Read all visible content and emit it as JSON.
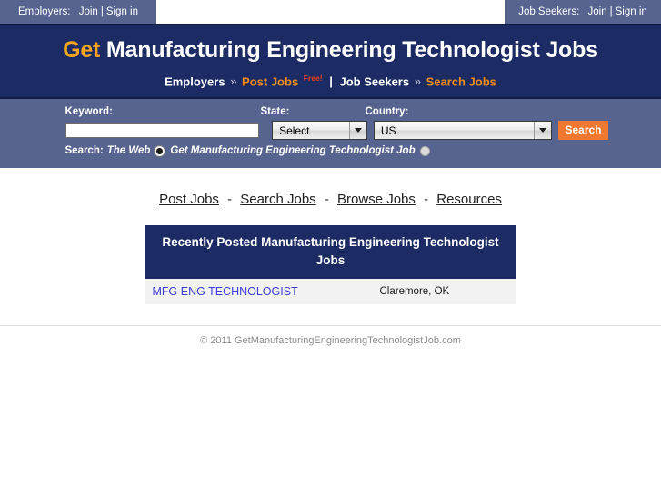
{
  "topbar": {
    "employers_label": "Employers:",
    "employers_join": "Join",
    "employers_signin": "Sign in",
    "jobseekers_label": "Job Seekers:",
    "jobseekers_join": "Join",
    "jobseekers_signin": "Sign in",
    "separator": "|",
    "bg_color": "#56648f"
  },
  "banner": {
    "title_prefix": "Get",
    "title_rest": "Manufacturing Engineering Technologist Jobs",
    "employers_word": "Employers",
    "chevron": "»",
    "post_jobs": "Post Jobs",
    "free_badge": "Free!",
    "pipe": "|",
    "jobseekers_word": "Job Seekers",
    "search_jobs": "Search Jobs",
    "bg_color": "#1c2b63",
    "accent_color": "#f5a51c",
    "link_color": "#f08c1c",
    "free_color": "#e8401f"
  },
  "search": {
    "keyword_label": "Keyword:",
    "state_label": "State:",
    "country_label": "Country:",
    "keyword_value": "",
    "keyword_placeholder": "",
    "state_value": "Select",
    "country_value": "US",
    "search_button": "Search",
    "scope_label": "Search:",
    "scope_web": "The Web",
    "scope_site": "Get Manufacturing Engineering Technologist Job",
    "scope_selected": "The Web",
    "panel_color": "#56648f",
    "button_color": "#f07830"
  },
  "nav": {
    "separator": "-",
    "items": [
      {
        "label": "Post Jobs"
      },
      {
        "label": "Search Jobs"
      },
      {
        "label": "Browse Jobs"
      },
      {
        "label": "Resources"
      }
    ]
  },
  "results": {
    "heading": "Recently Posted Manufacturing Engineering Technologist Jobs",
    "rows": [
      {
        "title": "MFG ENG TECHNOLOGIST",
        "location": "Claremore, OK"
      }
    ]
  },
  "footer": {
    "copyright": "© 2011 GetManufacturingEngineeringTechnologistJob.com"
  }
}
